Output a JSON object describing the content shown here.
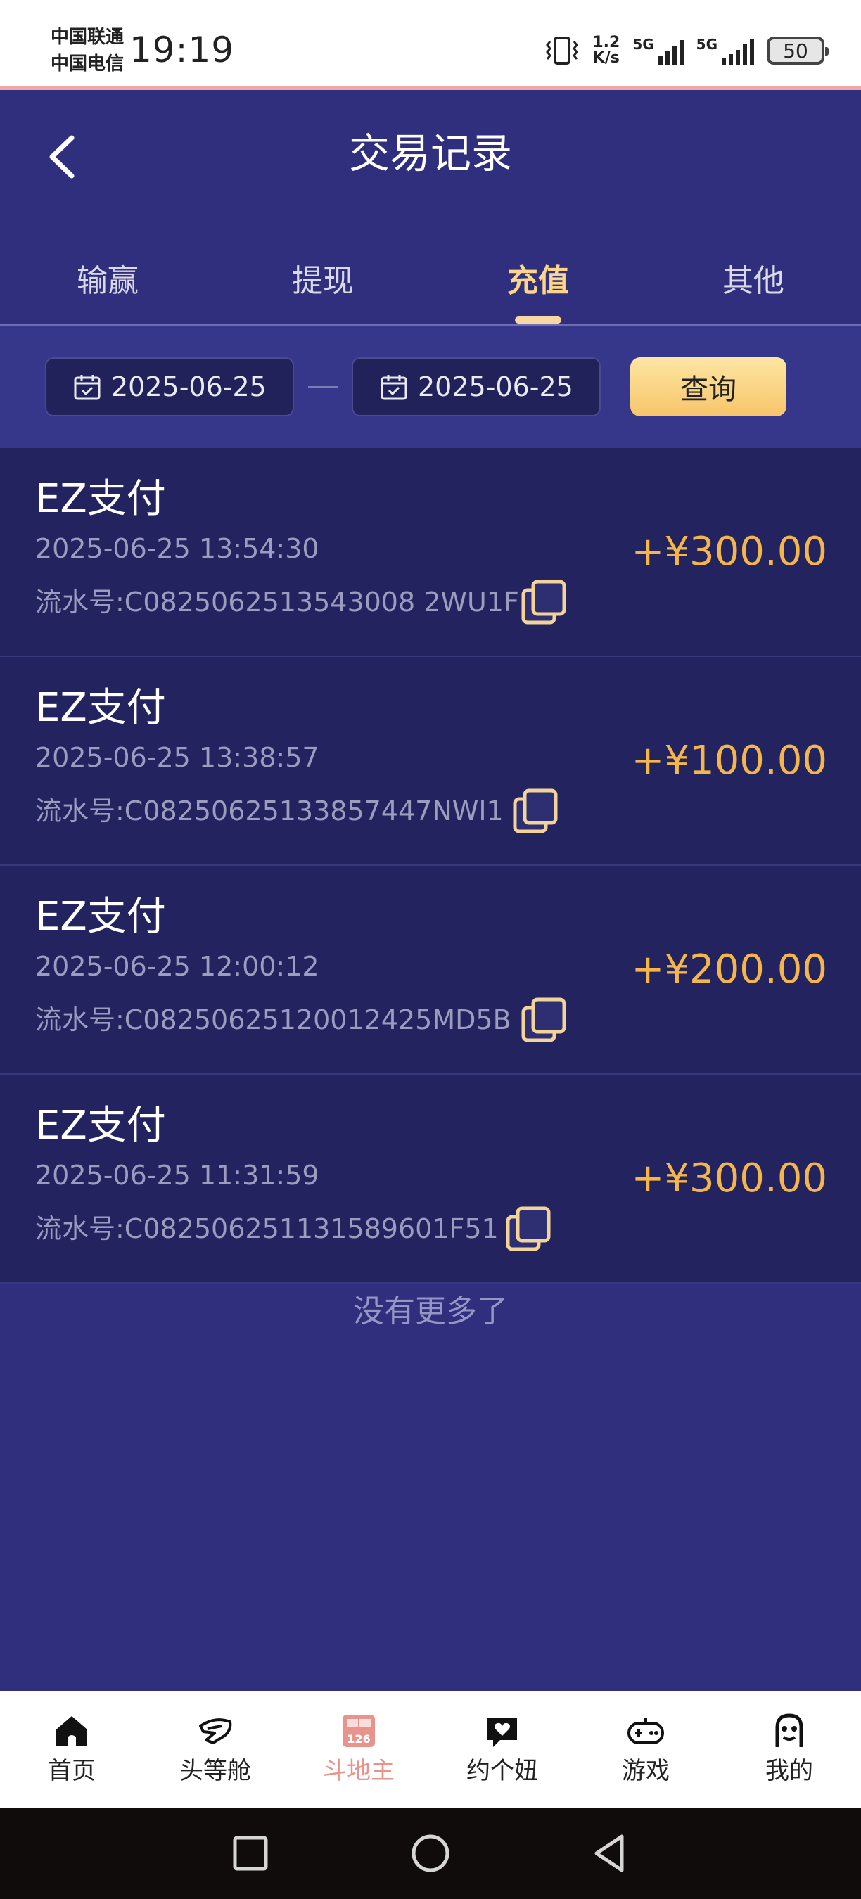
{
  "status_bar": {
    "carrier1": "中国联通",
    "carrier2": "中国电信",
    "time": "19:19",
    "net_speed_value": "1.2",
    "net_speed_unit": "K/s",
    "sim1_label": "5G",
    "sim2_label": "5G",
    "battery": "50"
  },
  "header": {
    "title": "交易记录"
  },
  "tabs": [
    {
      "label": "输赢",
      "active": false
    },
    {
      "label": "提现",
      "active": false
    },
    {
      "label": "充值",
      "active": true
    },
    {
      "label": "其他",
      "active": false
    }
  ],
  "filter": {
    "start_date": "2025-06-25",
    "end_date": "2025-06-25",
    "query_label": "查询"
  },
  "records": [
    {
      "title": "EZ支付",
      "time": "2025-06-25 13:54:30",
      "serial": "流水号:C0825062513543008 2WU1F",
      "amount": "+¥300.00"
    },
    {
      "title": "EZ支付",
      "time": "2025-06-25 13:38:57",
      "serial": "流水号:C08250625133857447NWI1",
      "amount": "+¥100.00"
    },
    {
      "title": "EZ支付",
      "time": "2025-06-25 12:00:12",
      "serial": "流水号:C08250625120012425MD5B",
      "amount": "+¥200.00"
    },
    {
      "title": "EZ支付",
      "time": "2025-06-25 11:31:59",
      "serial": "流水号:C082506251131589601F51",
      "amount": "+¥300.00"
    }
  ],
  "list_footer": "没有更多了",
  "bottom_nav": [
    {
      "label": "首页",
      "icon": "home-icon"
    },
    {
      "label": "头等舱",
      "icon": "airplane-icon"
    },
    {
      "label": "斗地主",
      "icon": "doudizhu-icon",
      "active": true
    },
    {
      "label": "约个妞",
      "icon": "heart-chat-icon"
    },
    {
      "label": "游戏",
      "icon": "gamepad-icon"
    },
    {
      "label": "我的",
      "icon": "profile-icon"
    }
  ],
  "colors": {
    "background": "#2f2f7e",
    "accent": "#fcd58c",
    "amount": "#f4b54a",
    "active_nav": "#e8948c"
  }
}
